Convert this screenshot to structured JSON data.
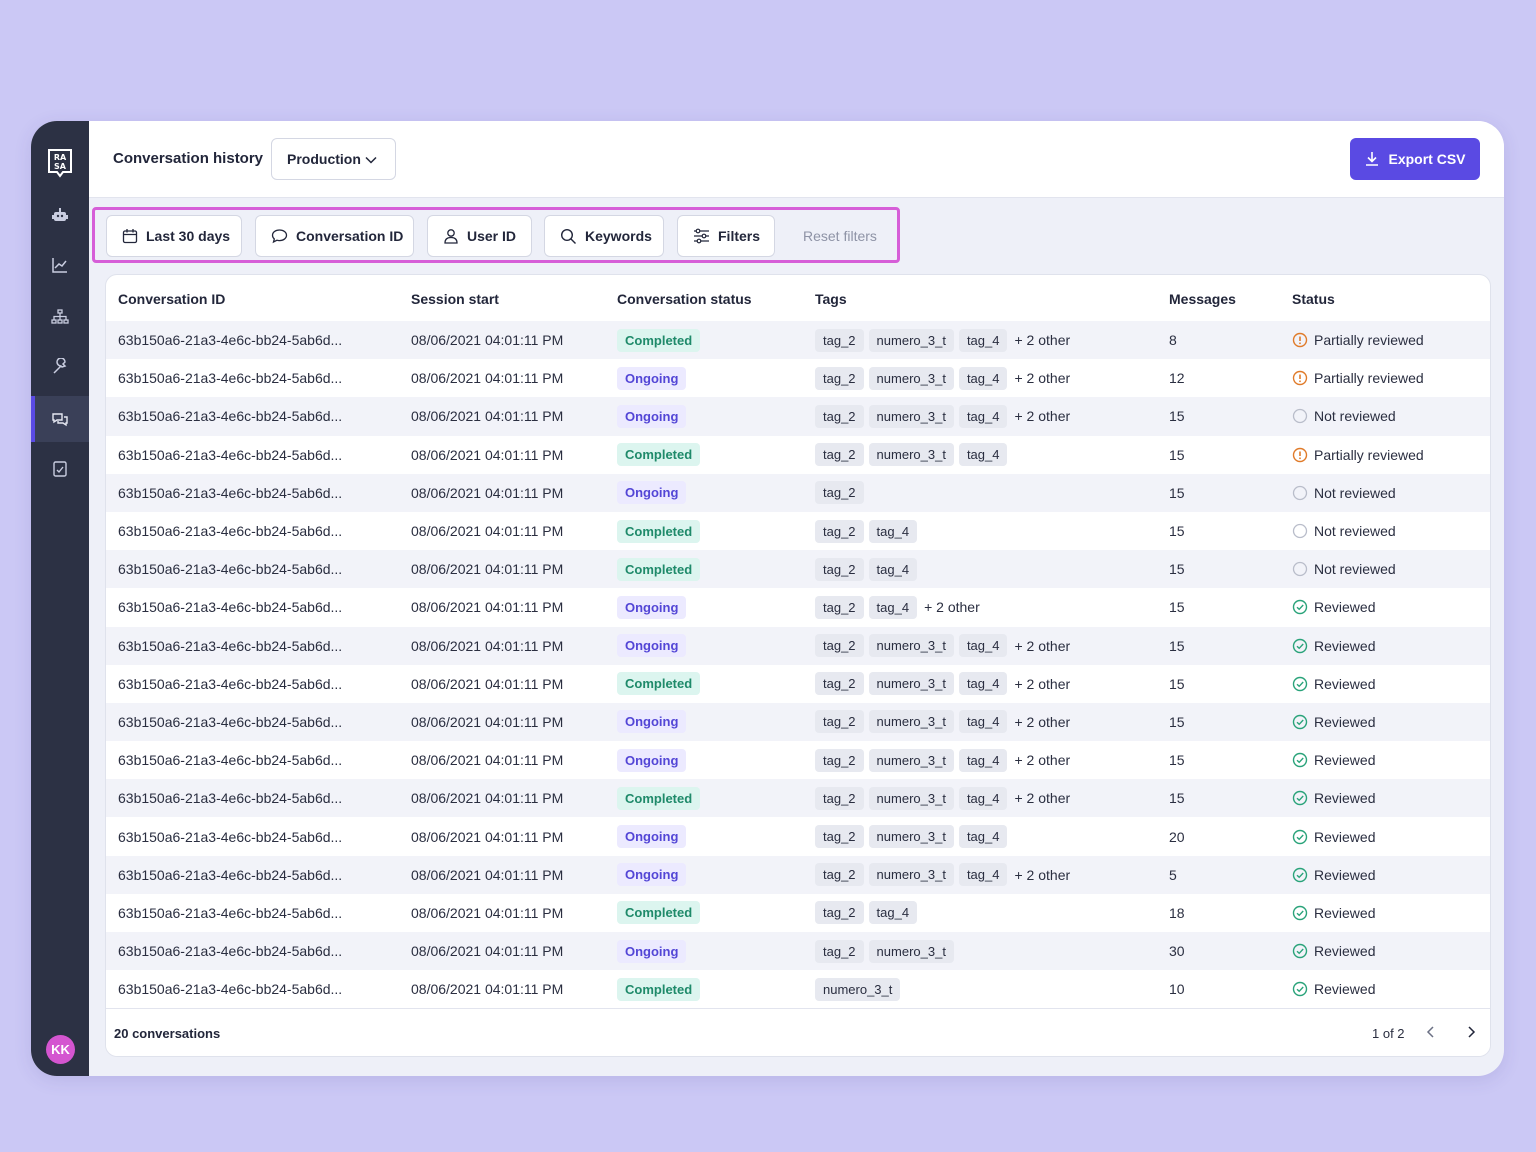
{
  "app": {
    "logo_text": "RASA",
    "user_initials": "KK"
  },
  "sidebar": {
    "items": [
      {
        "name": "robot-icon",
        "active": false
      },
      {
        "name": "analytics-icon",
        "active": false
      },
      {
        "name": "hierarchy-icon",
        "active": false
      },
      {
        "name": "wrench-icon",
        "active": false
      },
      {
        "name": "conversations-icon",
        "active": true
      },
      {
        "name": "checklist-icon",
        "active": false
      }
    ]
  },
  "header": {
    "title": "Conversation history",
    "environment": "Production",
    "export_label": "Export CSV"
  },
  "filters": {
    "date_range": "Last 30 days",
    "conversation_id": "Conversation ID",
    "user_id": "User ID",
    "keywords": "Keywords",
    "filters": "Filters",
    "reset": "Reset filters"
  },
  "table": {
    "columns": [
      "Conversation ID",
      "Session start",
      "Conversation status",
      "Tags",
      "Messages",
      "Status"
    ],
    "rows": [
      {
        "id": "63b150a6-21a3-4e6c-bb24-5ab6d...",
        "session": "08/06/2021 04:01:11 PM",
        "cstatus": "Completed",
        "tags": [
          "tag_2",
          "numero_3_t",
          "tag_4"
        ],
        "more": "+ 2 other",
        "messages": "8",
        "status": "Partially reviewed"
      },
      {
        "id": "63b150a6-21a3-4e6c-bb24-5ab6d...",
        "session": "08/06/2021 04:01:11 PM",
        "cstatus": "Ongoing",
        "tags": [
          "tag_2",
          "numero_3_t",
          "tag_4"
        ],
        "more": "+ 2 other",
        "messages": "12",
        "status": "Partially reviewed"
      },
      {
        "id": "63b150a6-21a3-4e6c-bb24-5ab6d...",
        "session": "08/06/2021 04:01:11 PM",
        "cstatus": "Ongoing",
        "tags": [
          "tag_2",
          "numero_3_t",
          "tag_4"
        ],
        "more": "+ 2 other",
        "messages": "15",
        "status": "Not reviewed"
      },
      {
        "id": "63b150a6-21a3-4e6c-bb24-5ab6d...",
        "session": "08/06/2021 04:01:11 PM",
        "cstatus": "Completed",
        "tags": [
          "tag_2",
          "numero_3_t",
          "tag_4"
        ],
        "more": "",
        "messages": "15",
        "status": "Partially reviewed"
      },
      {
        "id": "63b150a6-21a3-4e6c-bb24-5ab6d...",
        "session": "08/06/2021 04:01:11 PM",
        "cstatus": "Ongoing",
        "tags": [
          "tag_2"
        ],
        "more": "",
        "messages": "15",
        "status": "Not reviewed"
      },
      {
        "id": "63b150a6-21a3-4e6c-bb24-5ab6d...",
        "session": "08/06/2021 04:01:11 PM",
        "cstatus": "Completed",
        "tags": [
          "tag_2",
          "tag_4"
        ],
        "more": "",
        "messages": "15",
        "status": "Not reviewed"
      },
      {
        "id": "63b150a6-21a3-4e6c-bb24-5ab6d...",
        "session": "08/06/2021 04:01:11 PM",
        "cstatus": "Completed",
        "tags": [
          "tag_2",
          "tag_4"
        ],
        "more": "",
        "messages": "15",
        "status": "Not reviewed"
      },
      {
        "id": "63b150a6-21a3-4e6c-bb24-5ab6d...",
        "session": "08/06/2021 04:01:11 PM",
        "cstatus": "Ongoing",
        "tags": [
          "tag_2",
          "tag_4"
        ],
        "more": "+ 2 other",
        "messages": "15",
        "status": "Reviewed"
      },
      {
        "id": "63b150a6-21a3-4e6c-bb24-5ab6d...",
        "session": "08/06/2021 04:01:11 PM",
        "cstatus": "Ongoing",
        "tags": [
          "tag_2",
          "numero_3_t",
          "tag_4"
        ],
        "more": "+ 2 other",
        "messages": "15",
        "status": "Reviewed"
      },
      {
        "id": "63b150a6-21a3-4e6c-bb24-5ab6d...",
        "session": "08/06/2021 04:01:11 PM",
        "cstatus": "Completed",
        "tags": [
          "tag_2",
          "numero_3_t",
          "tag_4"
        ],
        "more": "+ 2 other",
        "messages": "15",
        "status": "Reviewed"
      },
      {
        "id": "63b150a6-21a3-4e6c-bb24-5ab6d...",
        "session": "08/06/2021 04:01:11 PM",
        "cstatus": "Ongoing",
        "tags": [
          "tag_2",
          "numero_3_t",
          "tag_4"
        ],
        "more": "+ 2 other",
        "messages": "15",
        "status": "Reviewed"
      },
      {
        "id": "63b150a6-21a3-4e6c-bb24-5ab6d...",
        "session": "08/06/2021 04:01:11 PM",
        "cstatus": "Ongoing",
        "tags": [
          "tag_2",
          "numero_3_t",
          "tag_4"
        ],
        "more": "+ 2 other",
        "messages": "15",
        "status": "Reviewed"
      },
      {
        "id": "63b150a6-21a3-4e6c-bb24-5ab6d...",
        "session": "08/06/2021 04:01:11 PM",
        "cstatus": "Completed",
        "tags": [
          "tag_2",
          "numero_3_t",
          "tag_4"
        ],
        "more": "+ 2 other",
        "messages": "15",
        "status": "Reviewed"
      },
      {
        "id": "63b150a6-21a3-4e6c-bb24-5ab6d...",
        "session": "08/06/2021 04:01:11 PM",
        "cstatus": "Ongoing",
        "tags": [
          "tag_2",
          "numero_3_t",
          "tag_4"
        ],
        "more": "",
        "messages": "20",
        "status": "Reviewed"
      },
      {
        "id": "63b150a6-21a3-4e6c-bb24-5ab6d...",
        "session": "08/06/2021 04:01:11 PM",
        "cstatus": "Ongoing",
        "tags": [
          "tag_2",
          "numero_3_t",
          "tag_4"
        ],
        "more": "+ 2 other",
        "messages": "5",
        "status": "Reviewed"
      },
      {
        "id": "63b150a6-21a3-4e6c-bb24-5ab6d...",
        "session": "08/06/2021 04:01:11 PM",
        "cstatus": "Completed",
        "tags": [
          "tag_2",
          "tag_4"
        ],
        "more": "",
        "messages": "18",
        "status": "Reviewed"
      },
      {
        "id": "63b150a6-21a3-4e6c-bb24-5ab6d...",
        "session": "08/06/2021 04:01:11 PM",
        "cstatus": "Ongoing",
        "tags": [
          "tag_2",
          "numero_3_t"
        ],
        "more": "",
        "messages": "30",
        "status": "Reviewed"
      },
      {
        "id": "63b150a6-21a3-4e6c-bb24-5ab6d...",
        "session": "08/06/2021 04:01:11 PM",
        "cstatus": "Completed",
        "tags": [
          "numero_3_t"
        ],
        "more": "",
        "messages": "10",
        "status": "Reviewed"
      }
    ]
  },
  "footer": {
    "count": "20 conversations",
    "page": "1 of 2"
  },
  "colors": {
    "accent": "#5a4ae3",
    "sidebar": "#2c3144",
    "completed_text": "#1f8a6a",
    "completed_bg": "#dcf5ef",
    "ongoing_text": "#5346d6",
    "ongoing_bg": "#eceaff",
    "partial": "#e07b2a",
    "reviewed": "#2aa37a",
    "not_reviewed": "#b9bdca",
    "highlight": "#d65ed8"
  }
}
